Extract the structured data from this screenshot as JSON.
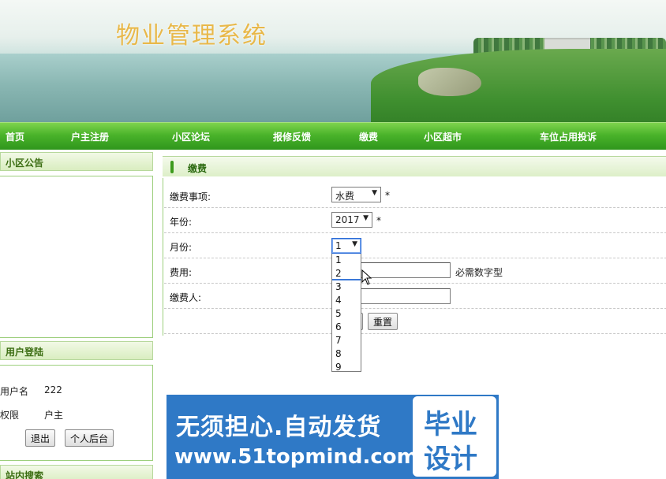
{
  "site": {
    "title": "物业管理系统"
  },
  "nav": {
    "items": [
      {
        "label": "首页"
      },
      {
        "label": "户主注册"
      },
      {
        "label": "小区论坛"
      },
      {
        "label": "报修反馈"
      },
      {
        "label": "缴费"
      },
      {
        "label": "小区超市"
      },
      {
        "label": "车位占用投诉"
      }
    ]
  },
  "sidebar": {
    "notice_title": "小区公告",
    "login_title": "用户登陆",
    "username_label": "用户名",
    "username_value": "222",
    "role_label": "权限",
    "role_value": "户主",
    "logout_label": "退出",
    "backend_label": "个人后台",
    "search_title": "站内搜索"
  },
  "main": {
    "section_title": "缴费",
    "form": {
      "item_label": "缴费事项:",
      "item_value": "水费",
      "year_label": "年份:",
      "year_value": "2017",
      "month_label": "月份:",
      "month_value": "1",
      "fee_label": "费用:",
      "fee_hint": "必需数字型",
      "payer_label": "缴费人:",
      "required_mark": "*",
      "reset_label": "重置"
    },
    "month_options": [
      "1",
      "2",
      "3",
      "4",
      "5",
      "6",
      "7",
      "8",
      "9"
    ]
  },
  "watermark": {
    "line1": "无须担心.自动发货",
    "line2": "www.51topmind.com",
    "badge_line1": "毕业",
    "badge_line2": "设计"
  },
  "colors": {
    "nav_green": "#3fa824",
    "title_gold": "#e8b84a",
    "section_green": "#2c6a10",
    "watermark_blue": "#2f79c6"
  }
}
